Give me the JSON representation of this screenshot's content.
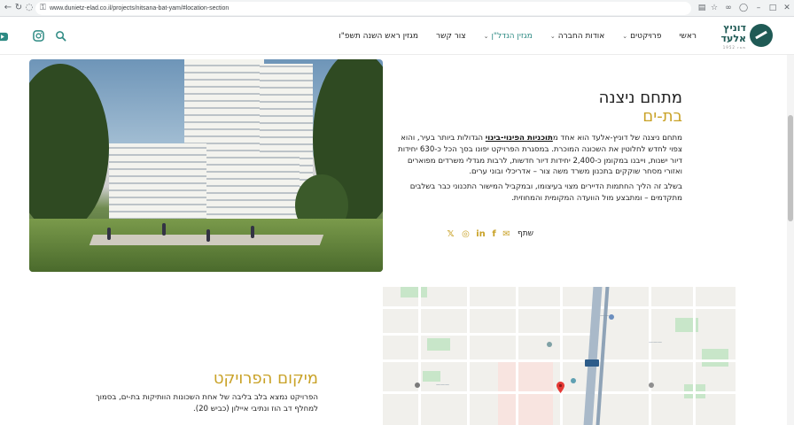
{
  "browser": {
    "url": "www.dunietz-elad.co.il/projects/nitsana-bat-yam/#location-section"
  },
  "header": {
    "logo": {
      "name_line1": "דוניץ",
      "name_line2": "אלעד",
      "since": "1952 מאז"
    },
    "nav": [
      {
        "label": "ראשי",
        "dropdown": false,
        "active": false
      },
      {
        "label": "פרויקטים",
        "dropdown": true,
        "active": false
      },
      {
        "label": "אודות החברה",
        "dropdown": true,
        "active": false
      },
      {
        "label": "מגזין הנדל\"ן",
        "dropdown": true,
        "active": true
      },
      {
        "label": "צור קשר",
        "dropdown": false,
        "active": false
      },
      {
        "label": "מגזין ראש השנה תשפ\"ו",
        "dropdown": false,
        "active": false
      }
    ]
  },
  "project": {
    "title": "מתחם ניצנה",
    "subtitle": "בת-ים",
    "desc_prefix": "מתחם ניצנה של דוניץ-אלעד הוא אחד מ",
    "desc_link": "תוכניות הפינוי-בינוי",
    "desc_suffix": " הגדולות ביותר בעיר, והוא צפוי לחדש לחלוטין את השכונה המוכרת. במסגרת הפרויקט יפונו בסך הכל כ-630 יחידות דיור ישנות, וייבנו במקומן כ-2,400 יחידות דיור חדשות, לרבות מגדלי משרדים מפוארים ואזורי מסחר שוקקים בתכנון משרד משה צור – אדריכלי ובוני ערים.",
    "desc2": "בשלב זה הליך החתמות הדיירים מצוי בעיצומו, ובמקביל המישור התכנוני כבר בשלבים מתקדמים – ומתבצע מול הוועדה המקומית והמחוזית.",
    "share_label": "שתף"
  },
  "location": {
    "title": "מיקום הפרויקט",
    "desc": "הפרויקט נמצא בלב בליבה של אחת השכונות הוותיקות בת-ים, בסמוך למחלף דב הוז ונתיבי איילון (כביש 20)."
  },
  "colors": {
    "accent_gold": "#c9a227",
    "brand_green": "#1f5a55",
    "nav_active": "#2d8a83"
  }
}
